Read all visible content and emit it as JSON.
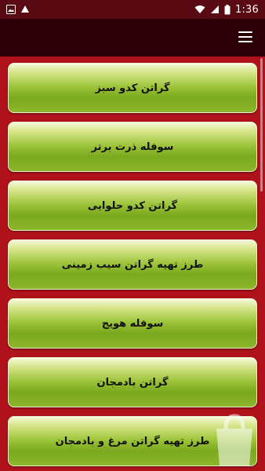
{
  "status_bar": {
    "time": "1:36",
    "icons": [
      "gallery-icon",
      "notification-icon",
      "wifi-icon",
      "cellular-icon",
      "battery-icon"
    ]
  },
  "app_bar": {
    "menu_icon": "hamburger-menu-icon"
  },
  "colors": {
    "status_bar_bg": "#5a0a12",
    "app_bar_bg": "#2a0006",
    "content_bg": "#b0121c",
    "item_green": "#9cc43a"
  },
  "items": [
    {
      "label": "گراتن کدو سبز"
    },
    {
      "label": "سوفله ذرت برتر"
    },
    {
      "label": "گراتن کدو حلوایی"
    },
    {
      "label": "طرز تهیه گراتن سیب زمینی"
    },
    {
      "label": "سوفله هویج"
    },
    {
      "label": "گراتن بادمجان"
    },
    {
      "label": "طرز تهیه گراتن مرغ و بادمجان"
    }
  ]
}
